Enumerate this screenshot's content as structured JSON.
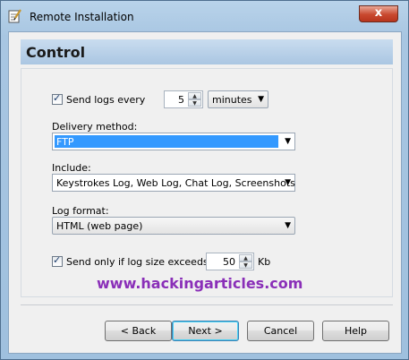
{
  "window": {
    "title": "Remote Installation",
    "close_label": "x"
  },
  "header": {
    "title": "Control"
  },
  "send_logs": {
    "checked": true,
    "label": "Send logs every",
    "interval_value": "5",
    "unit_value": "minutes"
  },
  "delivery": {
    "label": "Delivery method:",
    "value": "FTP"
  },
  "include": {
    "label": "Include:",
    "value": "Keystrokes Log, Web Log, Chat Log, Screenshots"
  },
  "log_format": {
    "label": "Log format:",
    "value": "HTML (web page)"
  },
  "size_limit": {
    "checked": true,
    "label": "Send only if log size exceeds",
    "value": "50",
    "unit": "Kb"
  },
  "watermark": "www.hackingarticles.com",
  "buttons": {
    "back": "< Back",
    "next": "Next >",
    "cancel": "Cancel",
    "help": "Help"
  },
  "colors": {
    "selection": "#3399ff",
    "watermark": "#8a2fb8"
  },
  "icons": {
    "app": "notepad-pencil-icon",
    "close": "close-icon",
    "spin_up": "spin-up-arrow-icon",
    "spin_down": "spin-down-arrow-icon",
    "dropdown": "dropdown-arrow-icon"
  }
}
